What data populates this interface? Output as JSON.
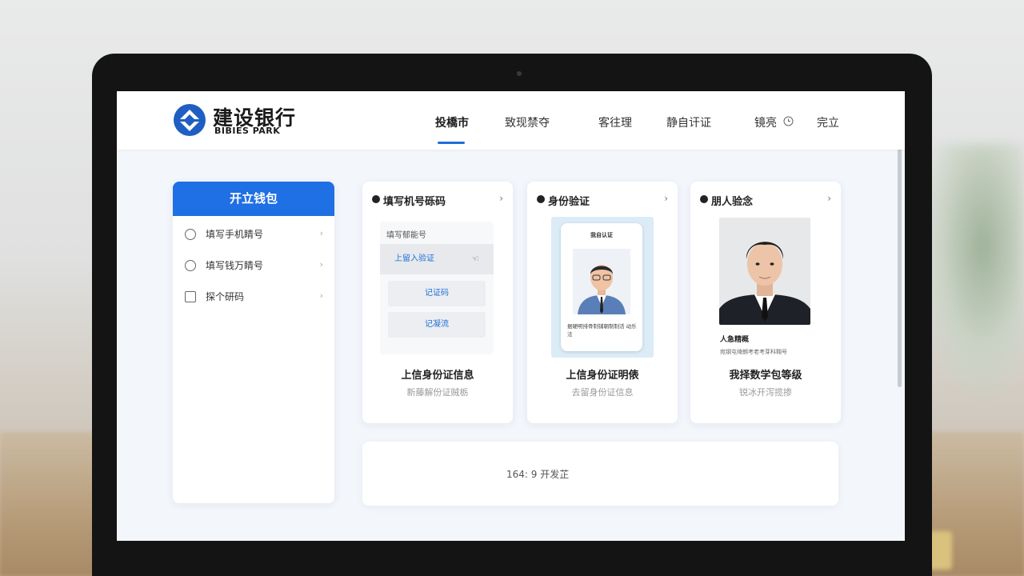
{
  "brand": {
    "name_cn": "建设银行",
    "name_en": "BIBIES PARK",
    "brand_color": "#1f6fd8"
  },
  "nav": {
    "items": [
      {
        "label": "投橋市",
        "active": true
      },
      {
        "label": "致现禁夺",
        "active": false
      },
      {
        "label": "客往理",
        "active": false
      },
      {
        "label": "静自讦证",
        "active": false
      },
      {
        "label": "镜亮",
        "active": false
      },
      {
        "label": "完立",
        "active": false
      }
    ],
    "clock_icon": "clock-icon"
  },
  "sidebar": {
    "title": "开立钱包",
    "items": [
      {
        "label": "填写手机睛号",
        "icon": "phone-circle-icon"
      },
      {
        "label": "填写钱万睛号",
        "icon": "wallet-circle-icon"
      },
      {
        "label": "探个研码",
        "icon": "square-icon"
      }
    ]
  },
  "cards": {
    "phone": {
      "title": "填写机号砾码",
      "form_label": "填写郁能号",
      "selected_option": "上留入验证",
      "buttons": [
        "记证码",
        "记凝流"
      ],
      "caption": "上信身份证信息",
      "subcaption": "新藤解份证贼栃"
    },
    "identity": {
      "title": "身份验证",
      "phone_header": "我自认证",
      "phone_text": "据硬明排骨制铺朝制制活 动乐法",
      "caption": "上信身份证明俵",
      "subcaption": "去留身份证信息"
    },
    "face": {
      "title": "朋人验念",
      "person_label": "人急精概",
      "person_note": "宛钢屯绮朗考老考芽科翱号",
      "caption": "我择数学包等级",
      "subcaption": "锐冰开泻揽掺"
    }
  },
  "bottom_panel": {
    "text": "164: 9 开发芷"
  }
}
